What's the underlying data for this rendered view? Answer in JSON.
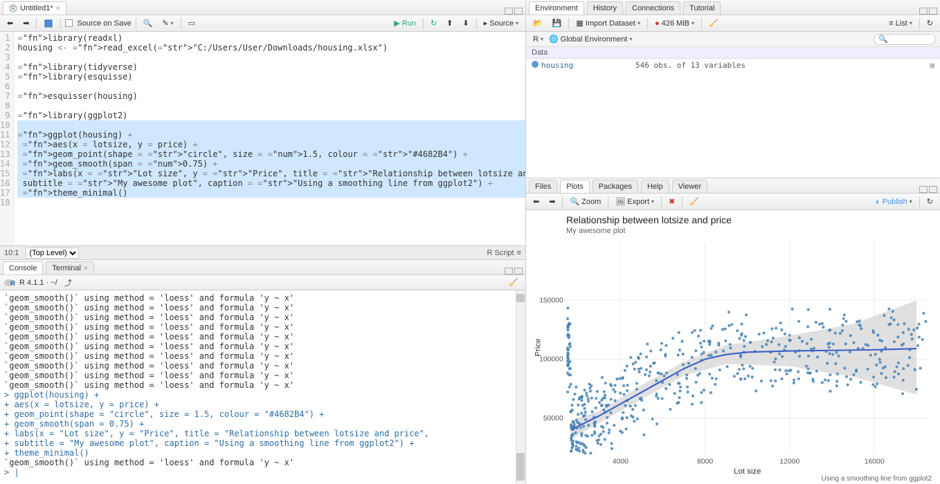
{
  "source": {
    "tab_name": "Untitled1*",
    "source_on_save": "Source on Save",
    "run": "Run",
    "source_btn": "Source",
    "status_pos": "10:1",
    "scope": "(Top Level)",
    "file_type": "R Script",
    "lines": [
      {
        "n": 1,
        "raw": "library(readxl)"
      },
      {
        "n": 2,
        "raw": "housing <- read_excel(\"C:/Users/User/Downloads/housing.xlsx\")"
      },
      {
        "n": 3,
        "raw": ""
      },
      {
        "n": 4,
        "raw": "library(tidyverse)"
      },
      {
        "n": 5,
        "raw": "library(esquisse)"
      },
      {
        "n": 6,
        "raw": ""
      },
      {
        "n": 7,
        "raw": "esquisser(housing)"
      },
      {
        "n": 8,
        "raw": ""
      },
      {
        "n": 9,
        "raw": "library(ggplot2)"
      },
      {
        "n": 10,
        "raw": "",
        "sel": true
      },
      {
        "n": 11,
        "raw": "ggplot(housing) +",
        "sel": true
      },
      {
        "n": 12,
        "raw": " aes(x = lotsize, y = price) +",
        "sel": true
      },
      {
        "n": 13,
        "raw": " geom_point(shape = \"circle\", size = 1.5, colour = \"#4682B4\") +",
        "sel": true
      },
      {
        "n": 14,
        "raw": " geom_smooth(span = 0.75) +",
        "sel": true
      },
      {
        "n": 15,
        "raw": " labs(x = \"Lot size\", y = \"Price\", title = \"Relationship between lotsize and price\",",
        "sel": true
      },
      {
        "n": 16,
        "raw": " subtitle = \"My awesome plot\", caption = \"Using a smoothing line from ggplot2\") +",
        "sel": true
      },
      {
        "n": 17,
        "raw": " theme_minimal()",
        "sel": true
      },
      {
        "n": 18,
        "raw": ""
      }
    ]
  },
  "console": {
    "tab_console": "Console",
    "tab_terminal": "Terminal",
    "prompt_path": "R 4.1.1 · ~/",
    "lines": [
      {
        "t": "`geom_smooth()` using method = 'loess' and formula 'y ~ x'",
        "c": "msg"
      },
      {
        "t": "`geom_smooth()` using method = 'loess' and formula 'y ~ x'",
        "c": "msg"
      },
      {
        "t": "`geom_smooth()` using method = 'loess' and formula 'y ~ x'",
        "c": "msg"
      },
      {
        "t": "`geom_smooth()` using method = 'loess' and formula 'y ~ x'",
        "c": "msg"
      },
      {
        "t": "`geom_smooth()` using method = 'loess' and formula 'y ~ x'",
        "c": "msg"
      },
      {
        "t": "`geom_smooth()` using method = 'loess' and formula 'y ~ x'",
        "c": "msg"
      },
      {
        "t": "`geom_smooth()` using method = 'loess' and formula 'y ~ x'",
        "c": "msg"
      },
      {
        "t": "`geom_smooth()` using method = 'loess' and formula 'y ~ x'",
        "c": "msg"
      },
      {
        "t": "`geom_smooth()` using method = 'loess' and formula 'y ~ x'",
        "c": "msg"
      },
      {
        "t": "`geom_smooth()` using method = 'loess' and formula 'y ~ x'",
        "c": "msg"
      },
      {
        "t": "> ggplot(housing) +",
        "c": "blue"
      },
      {
        "t": "+   aes(x = lotsize, y = price) +",
        "c": "blue"
      },
      {
        "t": "+   geom_point(shape = \"circle\", size = 1.5, colour = \"#4682B4\") +",
        "c": "blue"
      },
      {
        "t": "+   geom_smooth(span = 0.75) +",
        "c": "blue"
      },
      {
        "t": "+   labs(x = \"Lot size\", y = \"Price\", title = \"Relationship between lotsize and price\",",
        "c": "blue"
      },
      {
        "t": "+   subtitle = \"My awesome plot\", caption = \"Using a smoothing line from ggplot2\") +",
        "c": "blue"
      },
      {
        "t": "+   theme_minimal()",
        "c": "blue"
      },
      {
        "t": "`geom_smooth()` using method = 'loess' and formula 'y ~ x'",
        "c": "msg"
      },
      {
        "t": "> |",
        "c": "blue"
      }
    ]
  },
  "env": {
    "tabs": [
      "Environment",
      "History",
      "Connections",
      "Tutorial"
    ],
    "import": "Import Dataset",
    "mem": "426 MiB",
    "view": "List",
    "scope_r": "R",
    "scope_env": "Global Environment",
    "section": "Data",
    "rows": [
      {
        "name": "housing",
        "val": "546 obs. of 13 variables"
      }
    ]
  },
  "plots": {
    "tabs": [
      "Files",
      "Plots",
      "Packages",
      "Help",
      "Viewer"
    ],
    "zoom": "Zoom",
    "export": "Export",
    "publish": "Publish",
    "title": "Relationship between lotsize and price",
    "subtitle": "My awesome plot",
    "caption": "Using a smoothing line from ggplot2",
    "xlabel": "Lot size",
    "ylabel": "Price"
  },
  "chart_data": {
    "type": "scatter",
    "title": "Relationship between lotsize and price",
    "subtitle": "My awesome plot",
    "caption": "Using a smoothing line from ggplot2",
    "xlabel": "Lot size",
    "ylabel": "Price",
    "xlim": [
      1500,
      18500
    ],
    "ylim": [
      20000,
      200000
    ],
    "xticks": [
      4000,
      8000,
      12000,
      16000
    ],
    "yticks": [
      50000,
      100000,
      150000
    ],
    "n_points_approx": 546,
    "point_color": "#4682B4",
    "smooth_color": "#3b5fc4",
    "smooth_line": [
      {
        "x": 1650,
        "y": 40000
      },
      {
        "x": 3000,
        "y": 52000
      },
      {
        "x": 4000,
        "y": 62000
      },
      {
        "x": 5000,
        "y": 72000
      },
      {
        "x": 6000,
        "y": 82000
      },
      {
        "x": 7000,
        "y": 92000
      },
      {
        "x": 8000,
        "y": 100000
      },
      {
        "x": 9000,
        "y": 104000
      },
      {
        "x": 10000,
        "y": 106000
      },
      {
        "x": 12000,
        "y": 107000
      },
      {
        "x": 14000,
        "y": 107500
      },
      {
        "x": 16000,
        "y": 108000
      },
      {
        "x": 18000,
        "y": 109000
      }
    ],
    "smooth_ribbon_upper": [
      {
        "x": 1650,
        "y": 48000
      },
      {
        "x": 3000,
        "y": 56000
      },
      {
        "x": 5000,
        "y": 78000
      },
      {
        "x": 7000,
        "y": 98000
      },
      {
        "x": 9000,
        "y": 112000
      },
      {
        "x": 12000,
        "y": 120000
      },
      {
        "x": 15000,
        "y": 130000
      },
      {
        "x": 18000,
        "y": 150000
      }
    ],
    "smooth_ribbon_lower": [
      {
        "x": 1650,
        "y": 32000
      },
      {
        "x": 3000,
        "y": 46000
      },
      {
        "x": 5000,
        "y": 66000
      },
      {
        "x": 7000,
        "y": 86000
      },
      {
        "x": 9000,
        "y": 96000
      },
      {
        "x": 12000,
        "y": 94000
      },
      {
        "x": 15000,
        "y": 85000
      },
      {
        "x": 18000,
        "y": 70000
      }
    ]
  }
}
